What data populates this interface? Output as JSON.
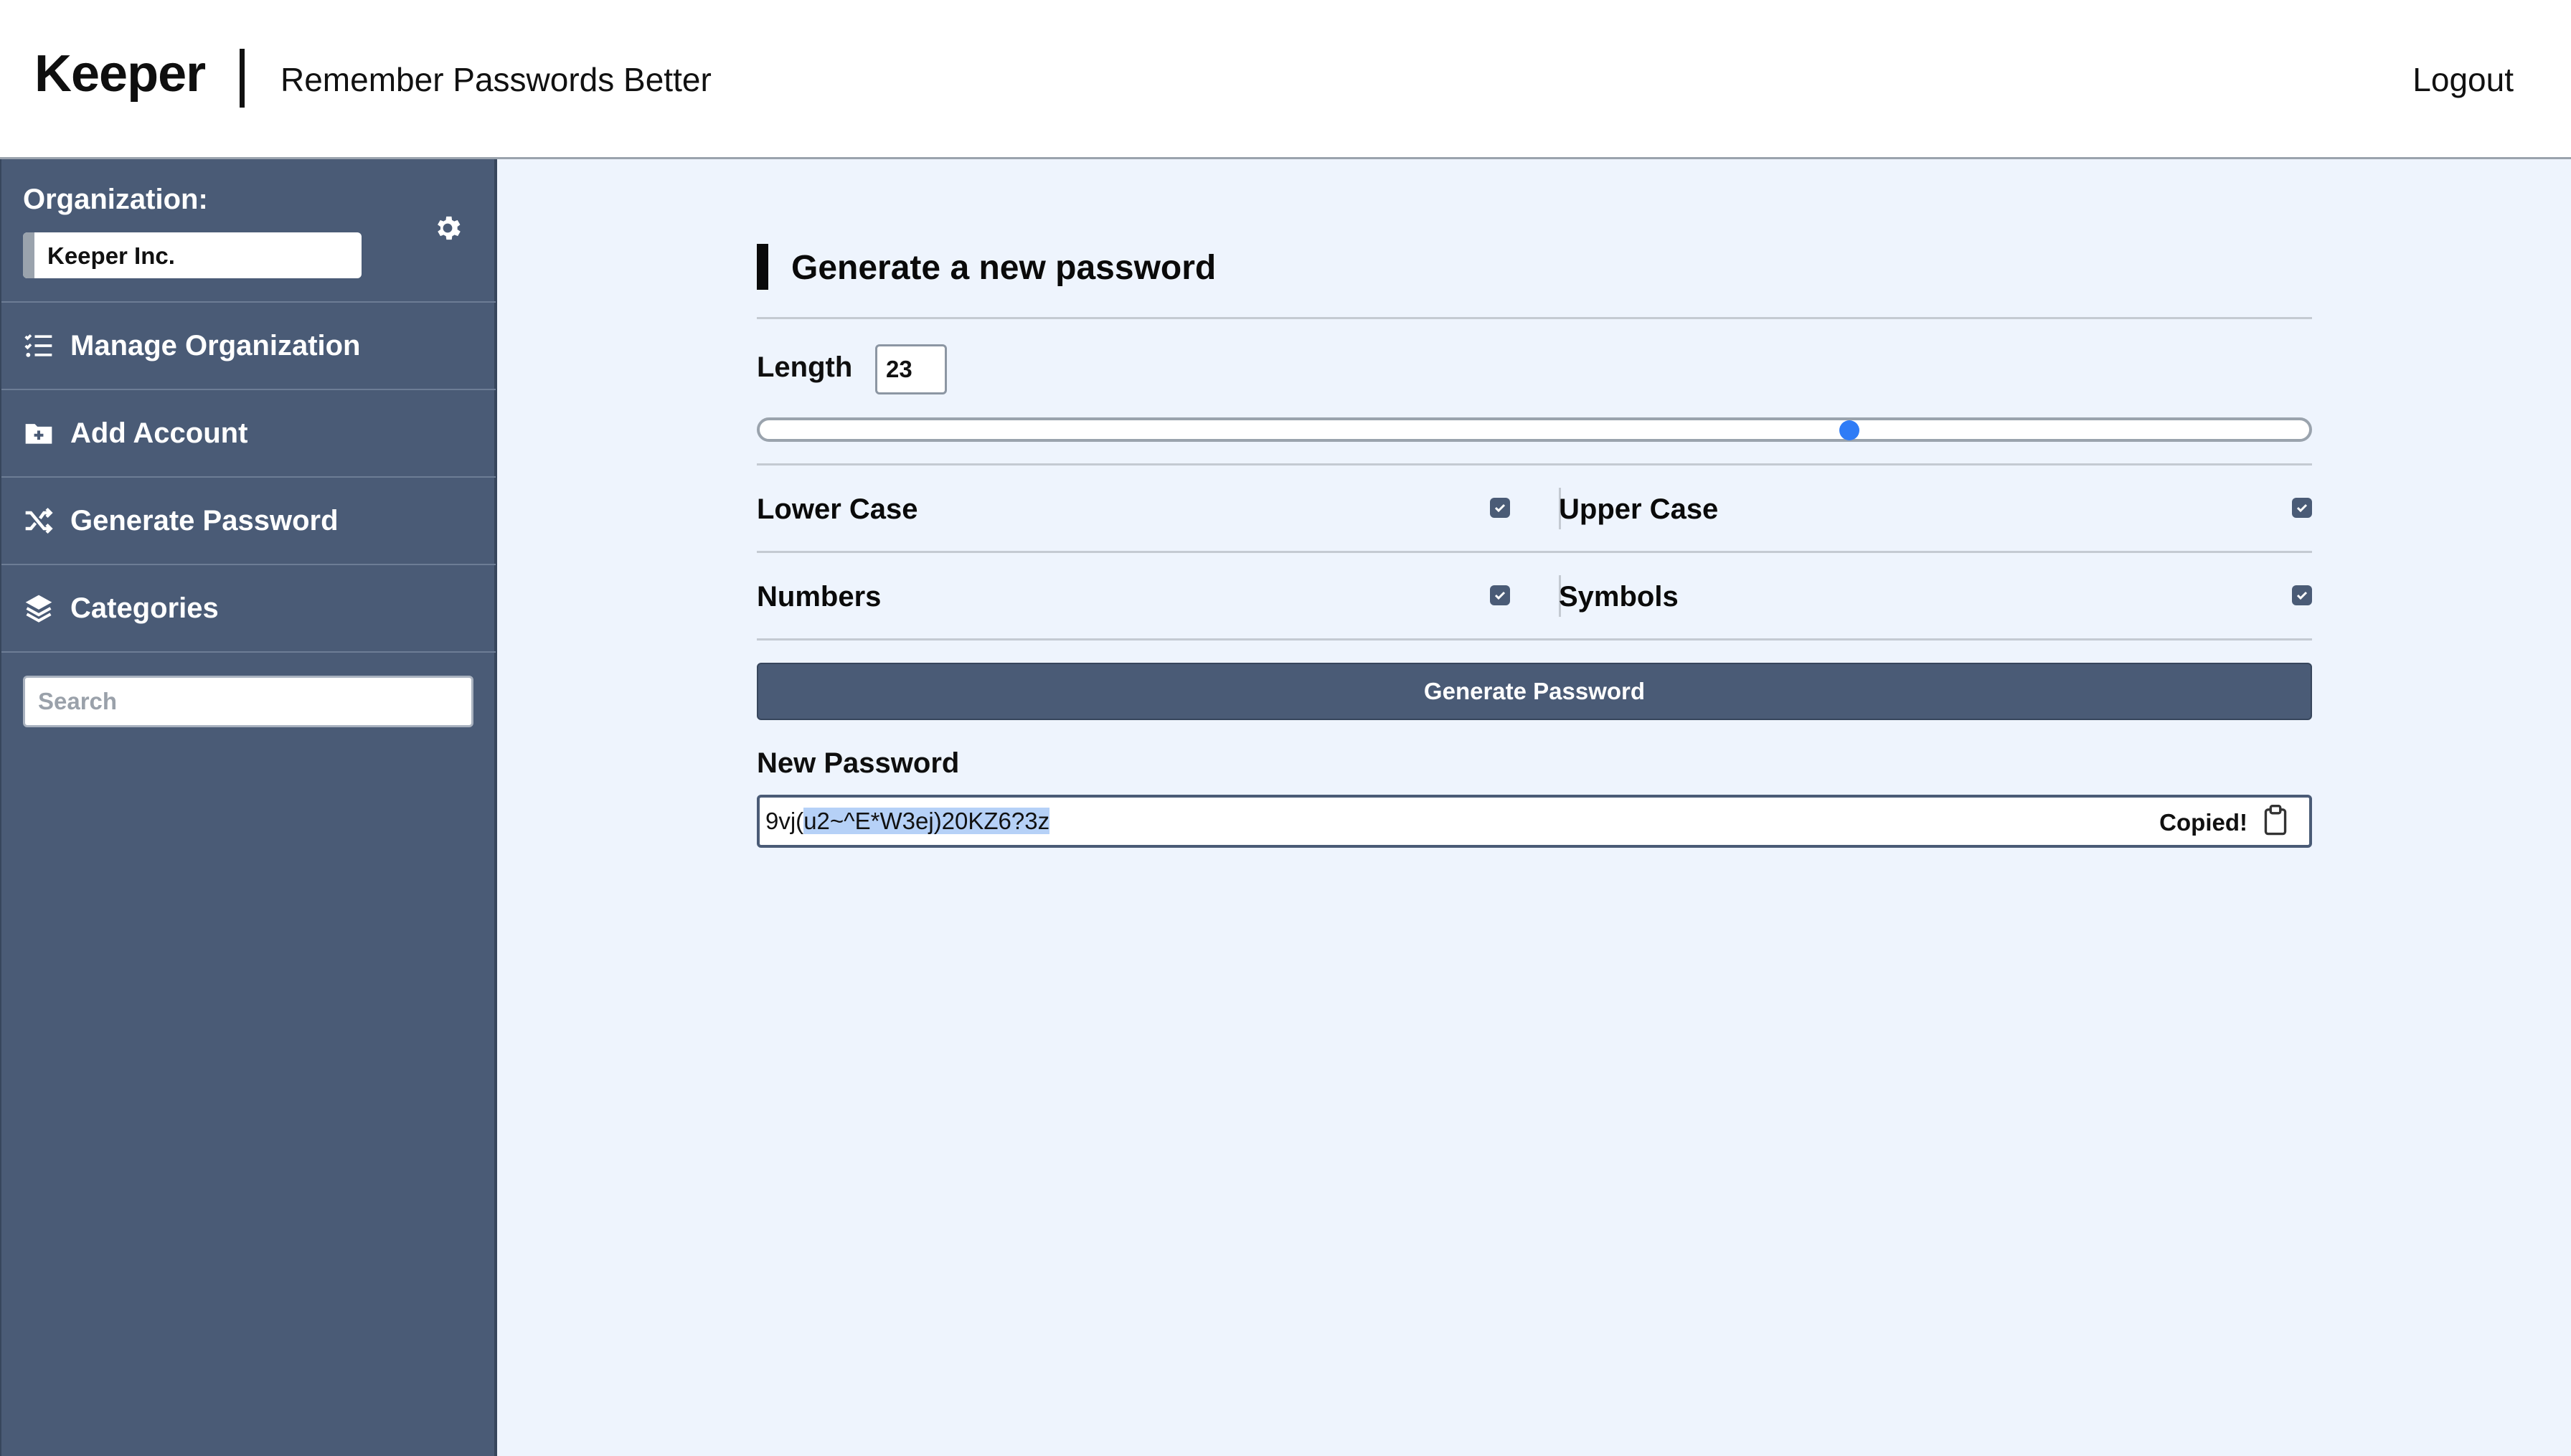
{
  "header": {
    "brand": "Keeper",
    "tagline": "Remember Passwords Better",
    "logout": "Logout"
  },
  "sidebar": {
    "org_label": "Organization:",
    "org_value": "Keeper Inc.",
    "items": [
      {
        "label": "Manage Organization",
        "icon": "list-check-icon"
      },
      {
        "label": "Add Account",
        "icon": "folder-plus-icon"
      },
      {
        "label": "Generate Password",
        "icon": "shuffle-icon"
      },
      {
        "label": "Categories",
        "icon": "layers-icon"
      }
    ],
    "search_placeholder": "Search"
  },
  "generator": {
    "title": "Generate a new password",
    "length_label": "Length",
    "length_value": "23",
    "length_fraction": 0.705,
    "options": [
      {
        "label": "Lower Case",
        "checked": true
      },
      {
        "label": "Upper Case",
        "checked": true
      },
      {
        "label": "Numbers",
        "checked": true
      },
      {
        "label": "Symbols",
        "checked": true
      }
    ],
    "button": "Generate Password",
    "new_password_label": "New Password",
    "password_prefix": "9vj(",
    "password_selected": "u2~^E*W3ej)20KZ6?3z",
    "copied": "Copied!"
  },
  "colors": {
    "sidebar": "#4a5b76",
    "main_bg": "#eef4fd",
    "accent": "#2f7cf6"
  }
}
